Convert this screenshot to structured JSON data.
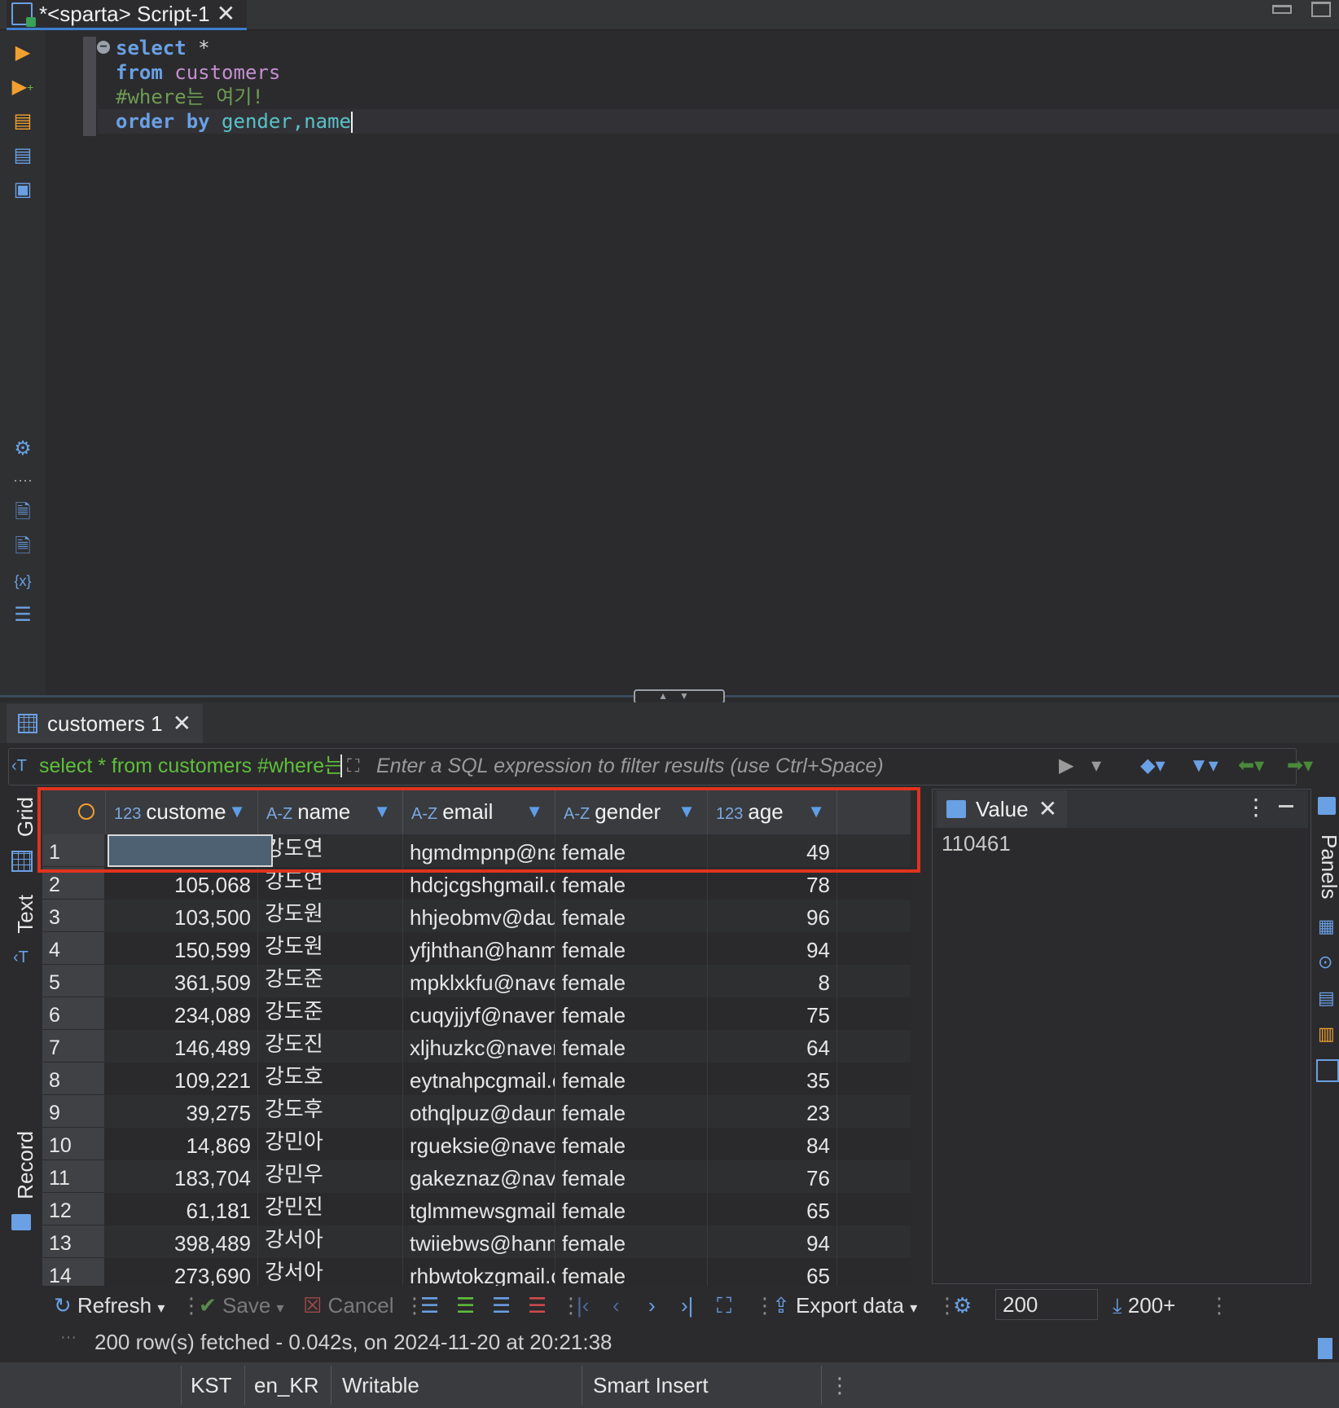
{
  "window": {
    "tab_title": "*<sparta> Script-1"
  },
  "editor": {
    "lines": [
      {
        "kw1": "select",
        "rest": " *"
      },
      {
        "kw1": "from",
        "table": "customers"
      },
      {
        "comment": "#where는 여기!"
      },
      {
        "kw1": "order by",
        "cols": "gender,name"
      }
    ]
  },
  "results": {
    "tab_label": "customers 1",
    "filter": {
      "query_preview": "select * from customers #where는 여기! order by gender,name",
      "placeholder": "Enter a SQL expression to filter results (use Ctrl+Space)"
    },
    "side_tabs": [
      "Grid",
      "Text",
      "Record"
    ],
    "columns": [
      {
        "type": "123",
        "label": "custome"
      },
      {
        "type": "A-Z",
        "label": "name"
      },
      {
        "type": "A-Z",
        "label": "email"
      },
      {
        "type": "A-Z",
        "label": "gender"
      },
      {
        "type": "123",
        "label": "age"
      }
    ],
    "rows": [
      {
        "n": "1",
        "id": "110,461",
        "name": "강도연",
        "email": "hgmdmpnp@naver.com",
        "gender": "female",
        "age": "49"
      },
      {
        "n": "2",
        "id": "105,068",
        "name": "강도연",
        "email": "hdcjcgshgmail.com",
        "gender": "female",
        "age": "78"
      },
      {
        "n": "3",
        "id": "103,500",
        "name": "강도원",
        "email": "hhjeobmv@daum.net",
        "gender": "female",
        "age": "96"
      },
      {
        "n": "4",
        "id": "150,599",
        "name": "강도원",
        "email": "yfjhthan@hanmail.net",
        "gender": "female",
        "age": "94"
      },
      {
        "n": "5",
        "id": "361,509",
        "name": "강도준",
        "email": "mpklxkfu@naver.com",
        "gender": "female",
        "age": "8"
      },
      {
        "n": "6",
        "id": "234,089",
        "name": "강도준",
        "email": "cuqyjjyf@naver.com",
        "gender": "female",
        "age": "75"
      },
      {
        "n": "7",
        "id": "146,489",
        "name": "강도진",
        "email": "xljhuzkc@naver.com",
        "gender": "female",
        "age": "64"
      },
      {
        "n": "8",
        "id": "109,221",
        "name": "강도호",
        "email": "eytnahpcgmail.com",
        "gender": "female",
        "age": "35"
      },
      {
        "n": "9",
        "id": "39,275",
        "name": "강도후",
        "email": "othqlpuz@daum.net",
        "gender": "female",
        "age": "23"
      },
      {
        "n": "10",
        "id": "14,869",
        "name": "강민아",
        "email": "rgueksie@naver.com",
        "gender": "female",
        "age": "84"
      },
      {
        "n": "11",
        "id": "183,704",
        "name": "강민우",
        "email": "gakeznaz@naver.com",
        "gender": "female",
        "age": "76"
      },
      {
        "n": "12",
        "id": "61,181",
        "name": "강민진",
        "email": "tglmmewsgmail.com",
        "gender": "female",
        "age": "65"
      },
      {
        "n": "13",
        "id": "398,489",
        "name": "강서아",
        "email": "twiiebws@hanmail.net",
        "gender": "female",
        "age": "94"
      },
      {
        "n": "14",
        "id": "273,690",
        "name": "강서아",
        "email": "rhbwtokzgmail.com",
        "gender": "female",
        "age": "65"
      }
    ],
    "value_panel": {
      "title": "Value",
      "value": "110461"
    },
    "right_panels_label": "Panels",
    "toolbar": {
      "refresh": "Refresh",
      "save": "Save",
      "cancel": "Cancel",
      "export": "Export data",
      "fetch_size": "200",
      "fetch_more": "200+"
    },
    "fetch_status": "200 row(s) fetched - 0.042s, on 2024-11-20 at 20:21:38"
  },
  "status_bar": {
    "timezone": "KST",
    "locale": "en_KR",
    "mode": "Writable",
    "insert_mode": "Smart Insert"
  }
}
